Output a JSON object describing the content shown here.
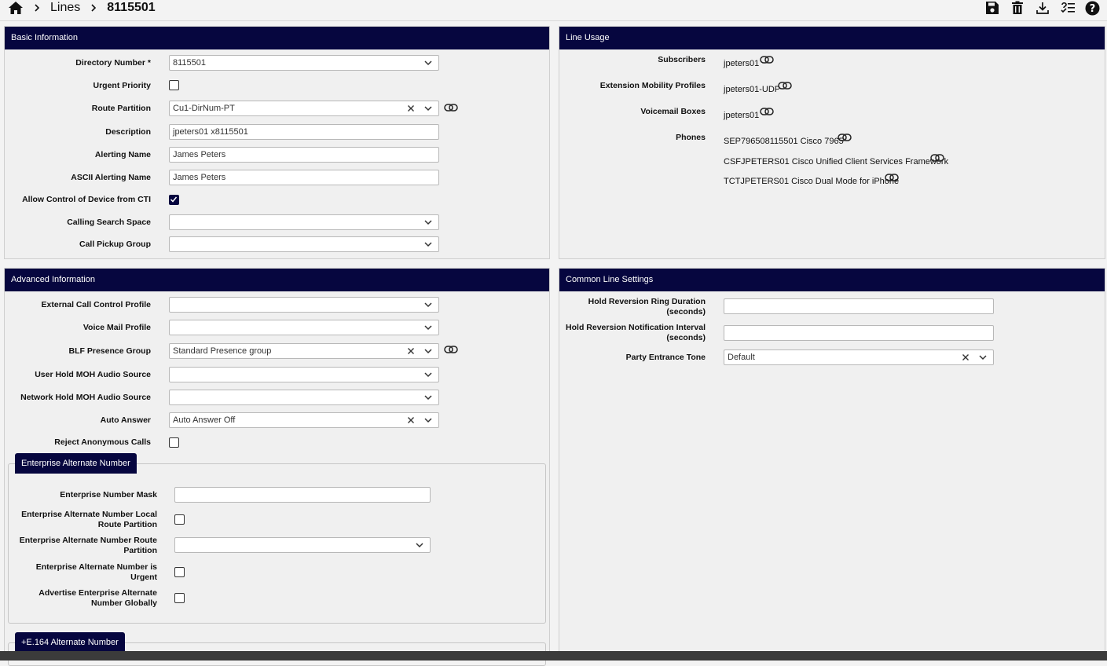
{
  "breadcrumb": {
    "home_icon": "home-icon",
    "section": "Lines",
    "current": "8115501"
  },
  "toolbar": {
    "icons": [
      "save-icon",
      "delete-icon",
      "download-icon",
      "list-check-icon",
      "help-icon"
    ]
  },
  "basic": {
    "title": "Basic Information",
    "directory_number_label": "Directory Number *",
    "directory_number_value": "8115501",
    "urgent_label": "Urgent Priority",
    "route_partition_label": "Route Partition",
    "route_partition_value": "Cu1-DirNum-PT",
    "description_label": "Description",
    "description_value": "jpeters01 x8115501",
    "alerting_name_label": "Alerting Name",
    "alerting_name_value": "James Peters",
    "ascii_alerting_label": "ASCII Alerting Name",
    "ascii_alerting_value": "James Peters",
    "allow_cti_label": "Allow Control of Device from CTI",
    "allow_cti_checked": true,
    "css_label": "Calling Search Space",
    "css_value": "",
    "pickup_label": "Call Pickup Group",
    "pickup_value": ""
  },
  "usage": {
    "title": "Line Usage",
    "subscribers_label": "Subscribers",
    "subscribers_value": "jpeters01",
    "em_label": "Extension Mobility Profiles",
    "em_value": "jpeters01-UDP",
    "vm_label": "Voicemail Boxes",
    "vm_value": "jpeters01",
    "phones_label": "Phones",
    "phones": [
      "SEP796508115501 Cisco 7965",
      "CSFJPETERS01 Cisco Unified Client Services Framework",
      "TCTJPETERS01 Cisco Dual Mode for iPhone"
    ]
  },
  "advanced": {
    "title": "Advanced Information",
    "ext_ccp_label": "External Call Control Profile",
    "vm_profile_label": "Voice Mail Profile",
    "blf_label": "BLF Presence Group",
    "blf_value": "Standard Presence group",
    "user_moh_label": "User Hold MOH Audio Source",
    "net_moh_label": "Network Hold MOH Audio Source",
    "auto_answer_label": "Auto Answer",
    "auto_answer_value": "Auto Answer Off",
    "reject_anon_label": "Reject Anonymous Calls",
    "ean_tab": "Enterprise Alternate Number",
    "ean_mask_label": "Enterprise Number Mask",
    "ean_local_rp_label_1": "Enterprise Alternate Number Local",
    "ean_local_rp_label_2": "Route Partition",
    "ean_rp_label_1": "Enterprise Alternate Number Route",
    "ean_rp_label_2": "Partition",
    "ean_urgent_label_1": "Enterprise Alternate Number is",
    "ean_urgent_label_2": "Urgent",
    "ean_adv_label_1": "Advertise Enterprise Alternate",
    "ean_adv_label_2": "Number Globally",
    "e164_tab": "+E.164 Alternate Number"
  },
  "common": {
    "title": "Common Line Settings",
    "hold_ring_label_1": "Hold Reversion Ring Duration",
    "hold_ring_label_2": "(seconds)",
    "hold_notif_label_1": "Hold Reversion Notification Interval",
    "hold_notif_label_2": "(seconds)",
    "party_tone_label": "Party Entrance Tone",
    "party_tone_value": "Default"
  },
  "colors": {
    "header": "#06063f",
    "background": "#f0f0f0"
  }
}
